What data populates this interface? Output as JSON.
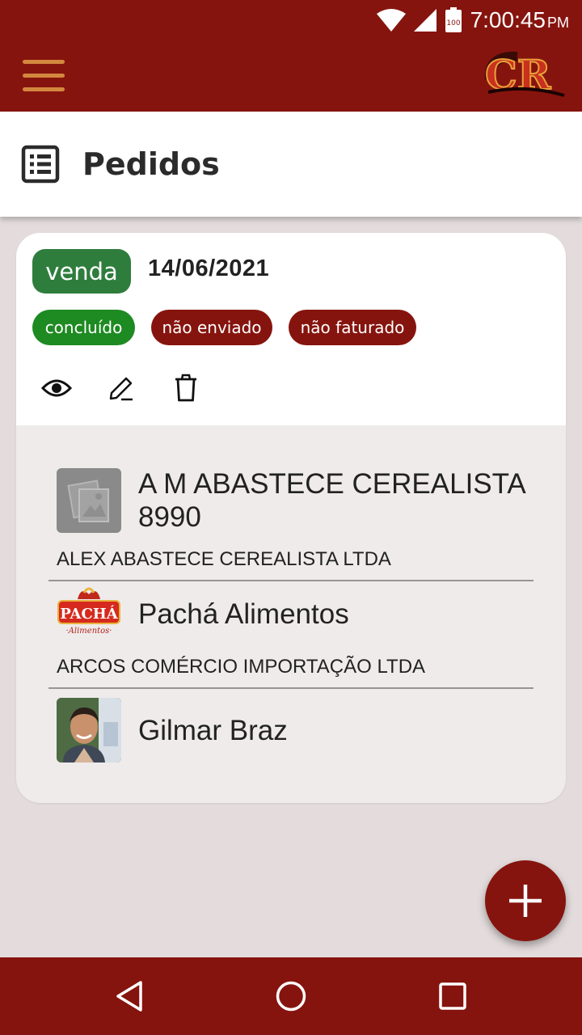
{
  "status_bar": {
    "time": "7:00:45",
    "ampm": "PM",
    "battery_level": "100",
    "icons": [
      "wifi-icon",
      "signal-icon",
      "battery-icon"
    ]
  },
  "app_bar": {
    "menu_icon": "hamburger-menu-icon",
    "logo_text": "CR",
    "accent_color": "#d4883f",
    "brand_color": "#86140e"
  },
  "page": {
    "icon": "list-alt-icon",
    "title": "Pedidos"
  },
  "order": {
    "type": "venda",
    "date": "14/06/2021",
    "chips": [
      {
        "label": "concluído",
        "color": "#1e8a22"
      },
      {
        "label": "não enviado",
        "color": "#86140e"
      },
      {
        "label": "não faturado",
        "color": "#86140e"
      }
    ],
    "actions": [
      {
        "icon": "eye-icon",
        "name": "view"
      },
      {
        "icon": "pencil-icon",
        "name": "edit"
      },
      {
        "icon": "trash-icon",
        "name": "delete"
      }
    ],
    "client": {
      "name_line1": "A M ABASTECE CEREALISTA",
      "name_line2": "8990",
      "legal_name": "ALEX ABASTECE CEREALISTA LTDA",
      "image": "placeholder-image-icon"
    },
    "supplier": {
      "name": "Pachá Alimentos",
      "legal_name": "ARCOS COMÉRCIO IMPORTAÇÃO LTDA",
      "logo_text": "PACHÁ",
      "logo_subtext": "·Alimentos·"
    },
    "seller": {
      "name": "Gilmar Braz",
      "image": "avatar"
    }
  },
  "fab": {
    "icon": "plus-icon"
  },
  "nav_bar": {
    "icons": [
      "back-icon",
      "home-icon",
      "recents-icon"
    ]
  }
}
